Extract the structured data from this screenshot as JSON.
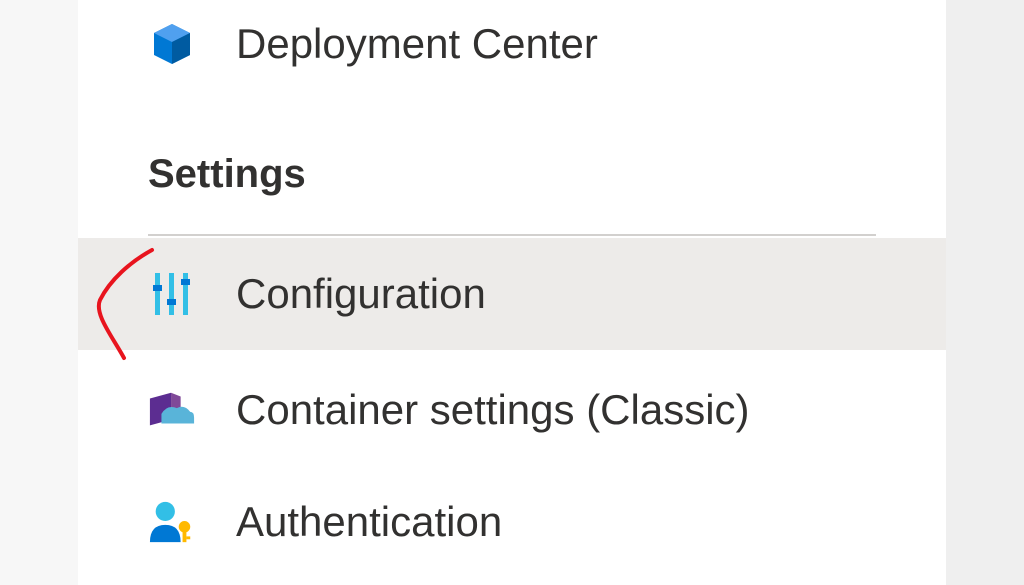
{
  "menu": {
    "items": [
      {
        "label": "Deployment Center",
        "icon": "deployment-cube-icon"
      },
      {
        "label": "Configuration",
        "icon": "configuration-sliders-icon",
        "selected": true
      },
      {
        "label": "Container settings (Classic)",
        "icon": "container-icon"
      },
      {
        "label": "Authentication",
        "icon": "user-key-icon"
      }
    ],
    "section_header": "Settings"
  },
  "colors": {
    "selected_bg": "#edebe9",
    "text": "#323130",
    "annotation": "#e8141e"
  }
}
